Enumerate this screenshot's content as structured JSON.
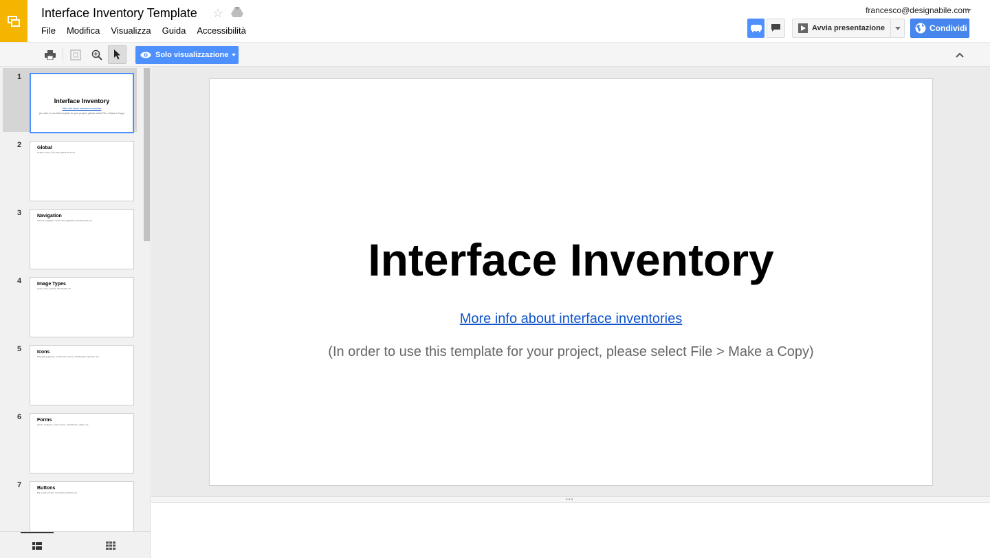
{
  "header": {
    "title": "Interface Inventory Template",
    "menu": [
      "File",
      "Modifica",
      "Visualizza",
      "Guida",
      "Accessibilità"
    ],
    "account": "francesco@designabile.com",
    "present_label": "Avvia presentazione",
    "share_label": "Condividi"
  },
  "toolbar": {
    "mode_label": "Solo visualizzazione"
  },
  "filmstrip": {
    "slides": [
      {
        "num": "1",
        "title": "Interface Inventory",
        "link": "More info about interface inventories",
        "note": "(In order to use this template for your project, please select File > Make a Copy)"
      },
      {
        "num": "2",
        "title": "Global",
        "subtitle": "Header, footer, and other global elements"
      },
      {
        "num": "3",
        "title": "Navigation",
        "subtitle": "Primary navigation, footer nav, pagination, breadcrumbs, etc"
      },
      {
        "num": "4",
        "title": "Image Types",
        "subtitle": "Logos, hero, avatars, thumbnails, etc"
      },
      {
        "num": "5",
        "title": "Icons",
        "subtitle": "Magnifying glasses, social icons, arrows, hamburgers, spinners, etc"
      },
      {
        "num": "6",
        "title": "Forms",
        "subtitle": "Inputs, textareas, select menus, checkboxes, radios, etc"
      },
      {
        "num": "7",
        "title": "Buttons",
        "subtitle": "Big, small, primary, secondary, disabled, etc"
      }
    ]
  },
  "slide": {
    "title": "Interface Inventory",
    "link": "More info about interface inventories",
    "note": "(In order to use this template for your project, please select File > Make a Copy)"
  },
  "colors": {
    "app_accent": "#f4b400",
    "primary_blue": "#4d90fe",
    "link_blue": "#1155cc"
  }
}
